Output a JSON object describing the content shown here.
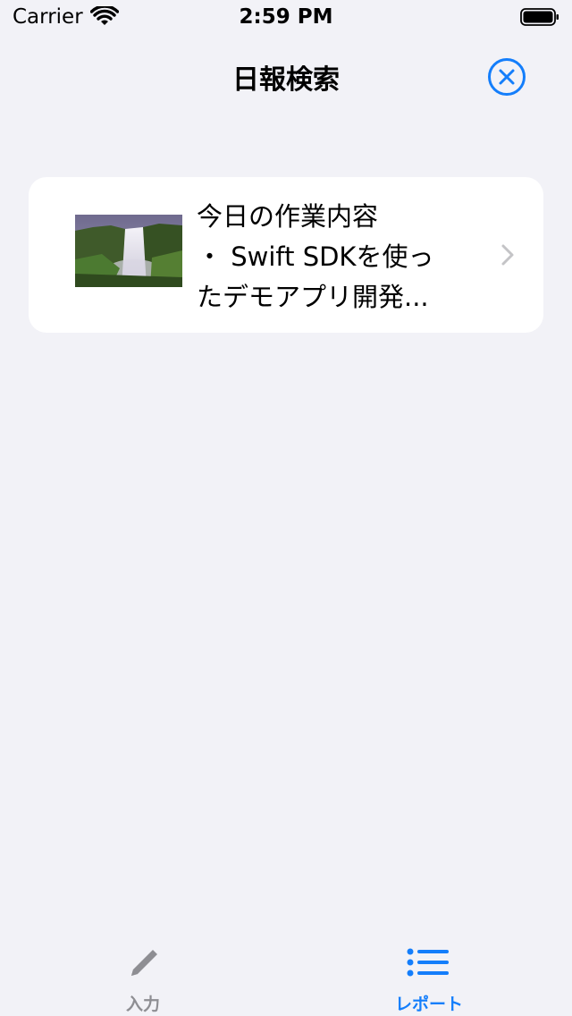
{
  "status_bar": {
    "carrier": "Carrier",
    "time": "2:59 PM",
    "icons": [
      "wifi-icon",
      "battery-icon"
    ]
  },
  "nav": {
    "title": "日報検索",
    "close_icon": "close-circle-icon"
  },
  "report": {
    "thumbnail": "waterfall-photo",
    "text": "今日の作業内容\n・ Swift SDKを使っ\nたデモアプリ開発...",
    "chevron_icon": "chevron-right-icon"
  },
  "tabs": [
    {
      "label": "入力",
      "icon": "pencil-icon",
      "selected": false
    },
    {
      "label": "レポート",
      "icon": "list-icon",
      "selected": true
    }
  ],
  "colors": {
    "accent": "#147efb",
    "inactive": "#8e8e93",
    "background": "#f2f2f7",
    "card": "#ffffff"
  }
}
